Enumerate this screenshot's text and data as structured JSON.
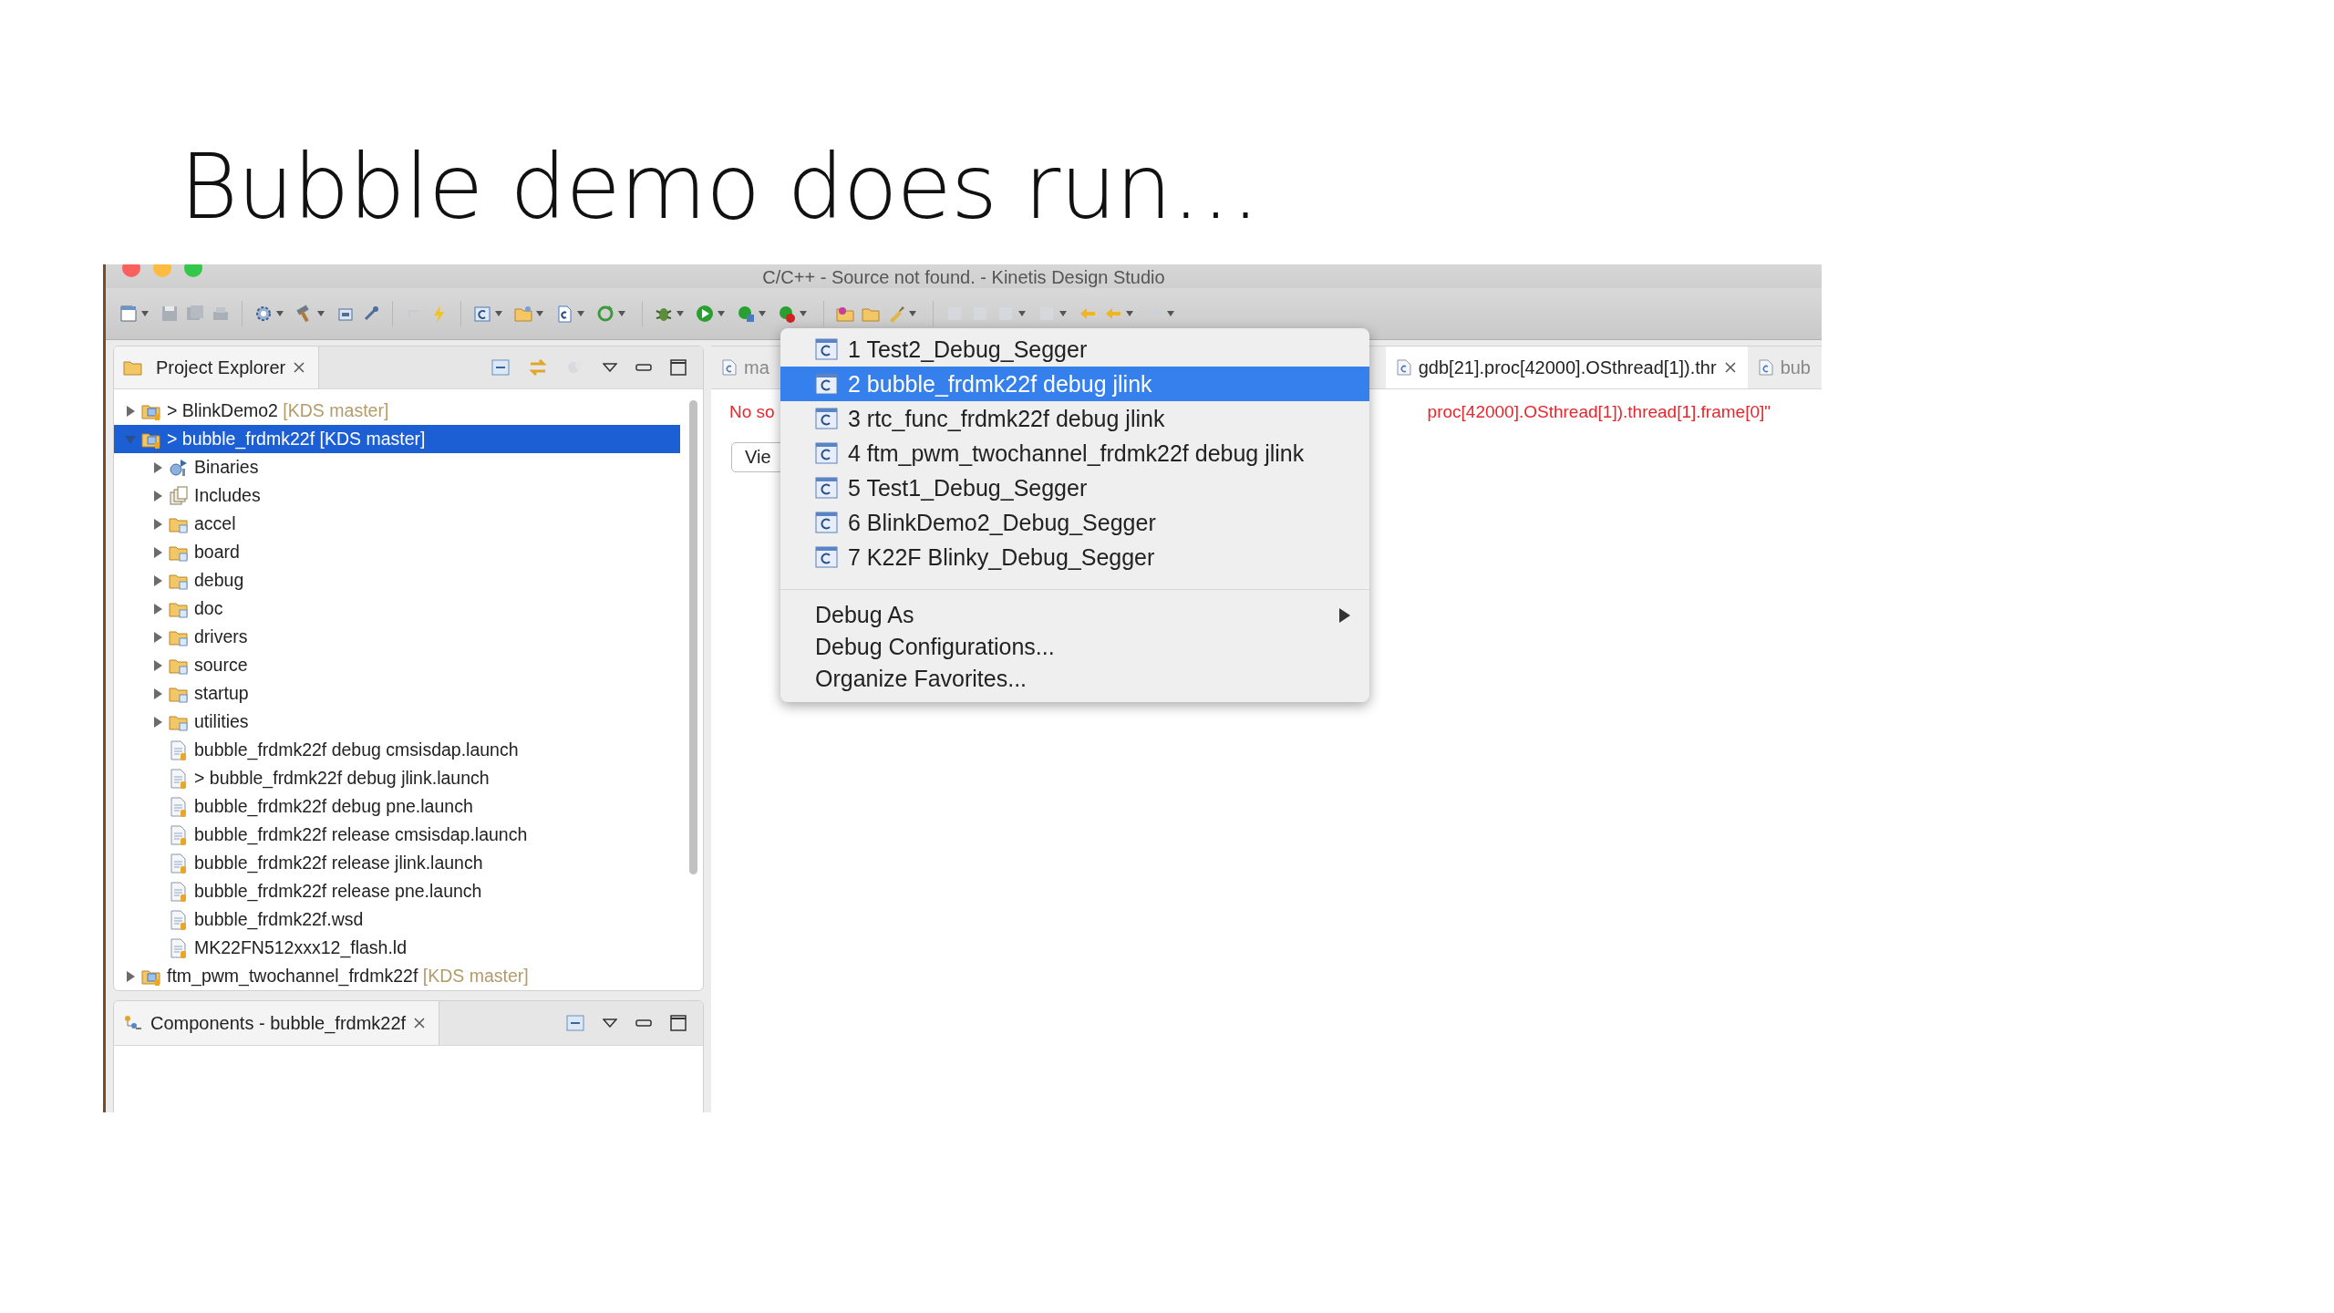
{
  "slide": {
    "title": "Bubble demo does run…"
  },
  "window": {
    "title": "C/C++ - Source not found. - Kinetis Design Studio"
  },
  "project_explorer": {
    "title": "Project Explorer",
    "tree": [
      {
        "kind": "project",
        "label": "> BlinkDemo2",
        "decoration": "[KDS master]",
        "expanded": false,
        "selected": false
      },
      {
        "kind": "project",
        "label": "> bubble_frdmk22f",
        "decoration": "[KDS master]",
        "expanded": true,
        "selected": true,
        "children": [
          {
            "kind": "binaries",
            "label": "Binaries",
            "expanded": false,
            "selected": false
          },
          {
            "kind": "includes",
            "label": "Includes",
            "expanded": false,
            "selected": false
          },
          {
            "kind": "folder",
            "label": "accel",
            "expanded": false,
            "selected": false
          },
          {
            "kind": "folder",
            "label": "board",
            "expanded": false,
            "selected": false
          },
          {
            "kind": "folder",
            "label": "debug",
            "expanded": false,
            "selected": false
          },
          {
            "kind": "folder",
            "label": "doc",
            "expanded": false,
            "selected": false
          },
          {
            "kind": "folder",
            "label": "drivers",
            "expanded": false,
            "selected": false
          },
          {
            "kind": "folder",
            "label": "source",
            "expanded": false,
            "selected": false
          },
          {
            "kind": "folder",
            "label": "startup",
            "expanded": false,
            "selected": false
          },
          {
            "kind": "folder",
            "label": "utilities",
            "expanded": false,
            "selected": false
          },
          {
            "kind": "file",
            "label": "bubble_frdmk22f debug cmsisdap.launch",
            "selected": false
          },
          {
            "kind": "file",
            "label": "> bubble_frdmk22f debug jlink.launch",
            "selected": false
          },
          {
            "kind": "file",
            "label": "bubble_frdmk22f debug pne.launch",
            "selected": false
          },
          {
            "kind": "file",
            "label": "bubble_frdmk22f release cmsisdap.launch",
            "selected": false
          },
          {
            "kind": "file",
            "label": "bubble_frdmk22f release jlink.launch",
            "selected": false
          },
          {
            "kind": "file",
            "label": "bubble_frdmk22f release pne.launch",
            "selected": false
          },
          {
            "kind": "file",
            "label": "bubble_frdmk22f.wsd",
            "selected": false
          },
          {
            "kind": "file",
            "label": "MK22FN512xxx12_flash.ld",
            "selected": false
          }
        ]
      },
      {
        "kind": "project",
        "label": "ftm_pwm_twochannel_frdmk22f",
        "decoration": "[KDS master]",
        "expanded": false,
        "selected": false
      }
    ]
  },
  "components": {
    "title": "Components - bubble_frdmk22f"
  },
  "editor": {
    "tabs": [
      {
        "label": "ma",
        "selected": false
      },
      {
        "label": "gdb[21].proc[42000].OSthread[1]).thr",
        "selected": true
      },
      {
        "label": "bub",
        "selected": false
      }
    ],
    "error_left": "No so",
    "error_right": "proc[42000].OSthread[1]).thread[1].frame[0]\"",
    "button": "Vie"
  },
  "debug_menu": {
    "favorites": [
      {
        "label": "1 Test2_Debug_Segger",
        "selected": false
      },
      {
        "label": "2 bubble_frdmk22f debug jlink",
        "selected": true
      },
      {
        "label": "3 rtc_func_frdmk22f debug jlink",
        "selected": false
      },
      {
        "label": "4 ftm_pwm_twochannel_frdmk22f debug jlink",
        "selected": false
      },
      {
        "label": "5 Test1_Debug_Segger",
        "selected": false
      },
      {
        "label": "6 BlinkDemo2_Debug_Segger",
        "selected": false
      },
      {
        "label": "7 K22F Blinky_Debug_Segger",
        "selected": false
      }
    ],
    "actions": [
      {
        "label": "Debug As",
        "submenu": true
      },
      {
        "label": "Debug Configurations...",
        "submenu": false
      },
      {
        "label": "Organize Favorites...",
        "submenu": false
      }
    ]
  }
}
